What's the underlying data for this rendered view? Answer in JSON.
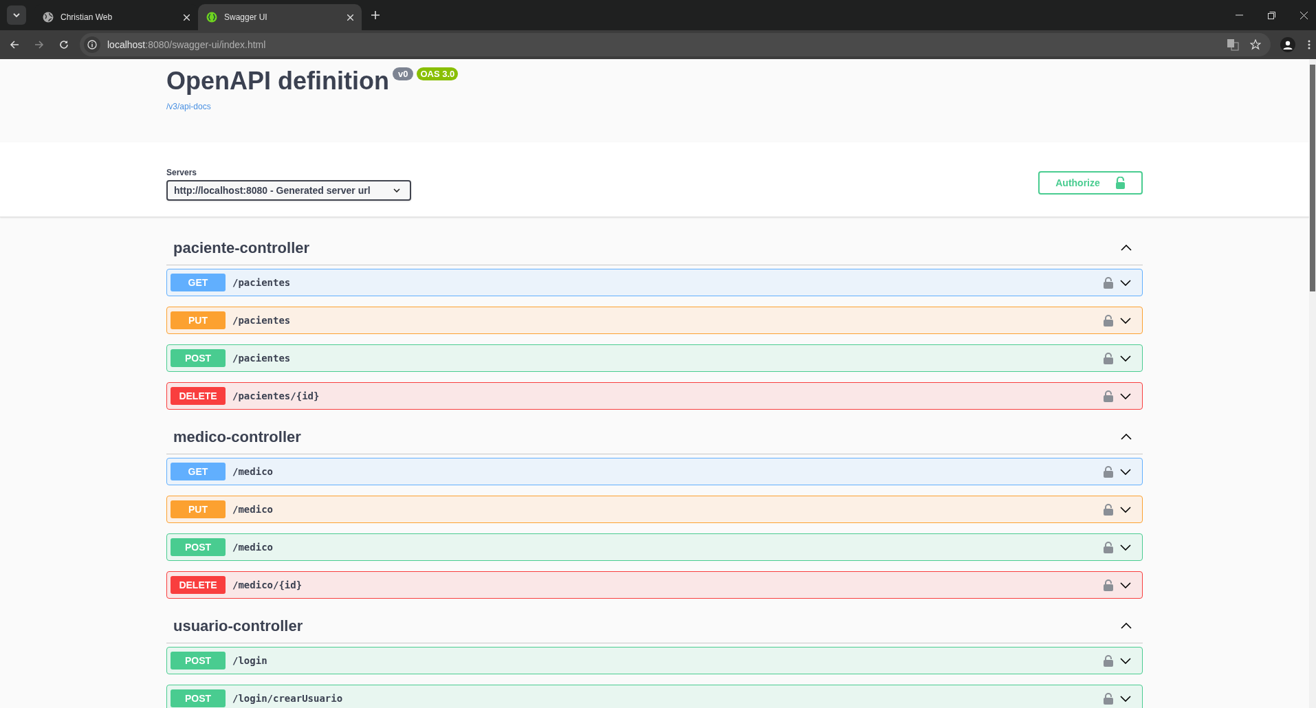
{
  "browser": {
    "tabs": [
      {
        "title": "Christian Web",
        "selected": false
      },
      {
        "title": "Swagger UI",
        "selected": true
      }
    ],
    "url_host": "localhost",
    "url_rest": ":8080/swagger-ui/index.html"
  },
  "info": {
    "title": "OpenAPI definition",
    "version": "v0",
    "oas": "OAS 3.0",
    "link": "/v3/api-docs"
  },
  "servers": {
    "label": "Servers",
    "value": "http://localhost:8080 - Generated server url"
  },
  "authorize": "Authorize",
  "tags": [
    {
      "name": "paciente-controller",
      "expanded": true,
      "operations": [
        {
          "kind": "get",
          "method": "GET",
          "path": "/pacientes"
        },
        {
          "kind": "put",
          "method": "PUT",
          "path": "/pacientes"
        },
        {
          "kind": "post",
          "method": "POST",
          "path": "/pacientes"
        },
        {
          "kind": "delete",
          "method": "DELETE",
          "path": "/pacientes/{id}"
        }
      ]
    },
    {
      "name": "medico-controller",
      "expanded": true,
      "operations": [
        {
          "kind": "get",
          "method": "GET",
          "path": "/medico"
        },
        {
          "kind": "put",
          "method": "PUT",
          "path": "/medico"
        },
        {
          "kind": "post",
          "method": "POST",
          "path": "/medico"
        },
        {
          "kind": "delete",
          "method": "DELETE",
          "path": "/medico/{id}"
        }
      ]
    },
    {
      "name": "usuario-controller",
      "expanded": true,
      "operations": [
        {
          "kind": "post",
          "method": "POST",
          "path": "/login"
        },
        {
          "kind": "post",
          "method": "POST",
          "path": "/login/crearUsuario"
        }
      ]
    }
  ]
}
